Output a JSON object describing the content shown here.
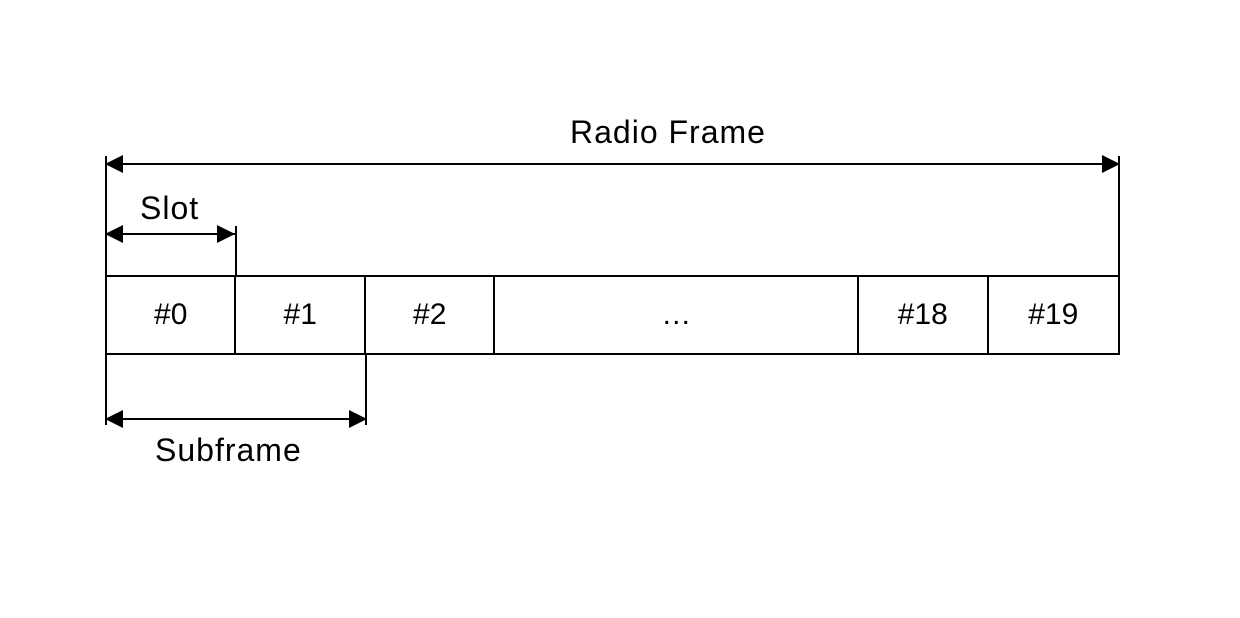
{
  "labels": {
    "radio_frame": "Radio Frame",
    "slot": "Slot",
    "subframe": "Subframe"
  },
  "cells": {
    "c0": "#0",
    "c1": "#1",
    "c2": "#2",
    "ellipsis": "…",
    "c18": "#18",
    "c19": "#19"
  }
}
